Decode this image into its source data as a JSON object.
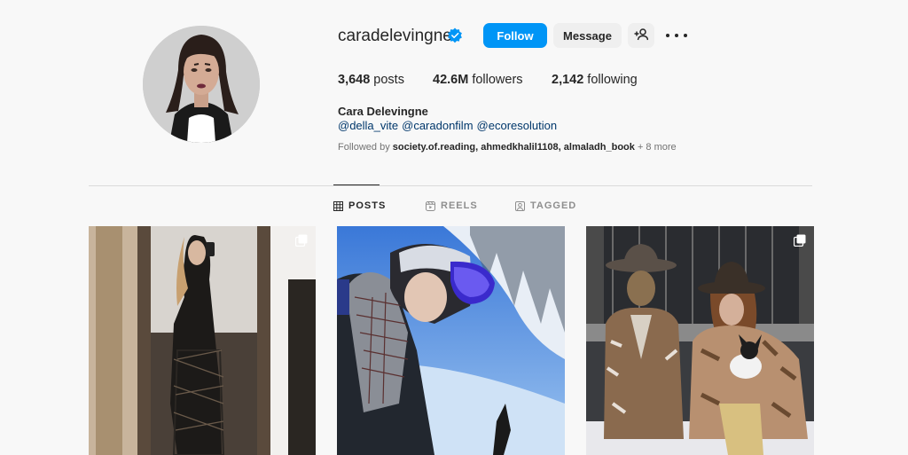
{
  "profile": {
    "username": "caradelevingne",
    "full_name": "Cara Delevingne",
    "bio_links": [
      "@della_vite",
      "@caradonfilm",
      "@ecoresolution"
    ],
    "followed_by_prefix": "Followed by",
    "followed_by_accounts": [
      "society.of.reading",
      "ahmedkhalil1108",
      "almaladh_book"
    ],
    "followed_by_more": "+ 8 more"
  },
  "actions": {
    "follow_label": "Follow",
    "message_label": "Message"
  },
  "stats": {
    "posts_count": "3,648",
    "posts_label": "posts",
    "followers_count": "42.6M",
    "followers_label": "followers",
    "following_count": "2,142",
    "following_label": "following"
  },
  "tabs": [
    {
      "label": "POSTS",
      "icon": "grid-icon",
      "active": true
    },
    {
      "label": "REELS",
      "icon": "reels-icon",
      "active": false
    },
    {
      "label": "TAGGED",
      "icon": "tagged-icon",
      "active": false
    }
  ],
  "colors": {
    "background": "#f8f8f8",
    "follow_button": "#0095f6",
    "secondary_button": "#efefef",
    "link": "#00376b",
    "muted_text": "#737373",
    "verified_badge": "#0095f6"
  }
}
